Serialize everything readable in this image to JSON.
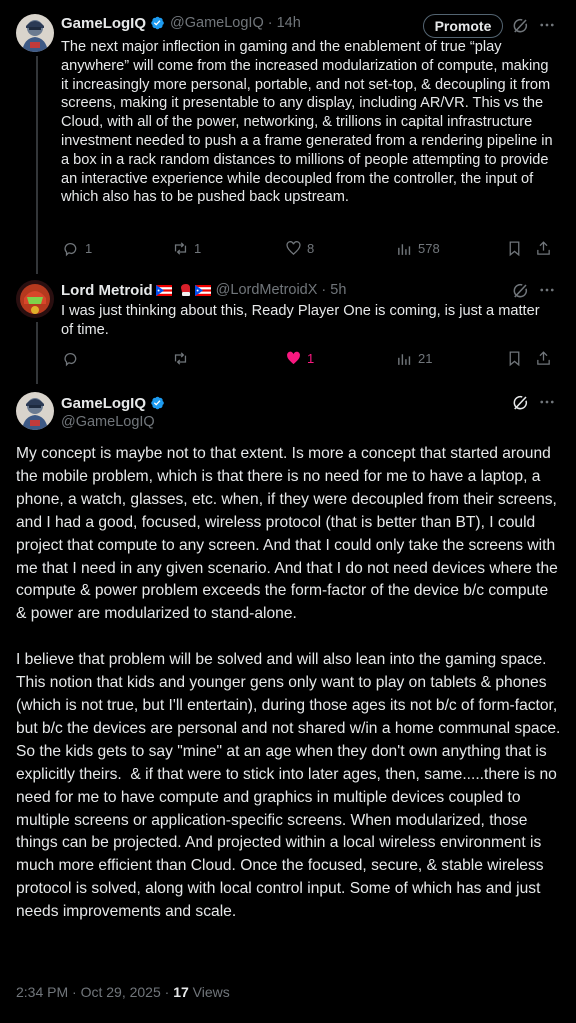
{
  "tweet1": {
    "name": "GameLogIQ",
    "handle": "@GameLogIQ",
    "time": "14h",
    "promote_label": "Promote",
    "text": "The next major inflection in gaming and the enablement of true “play anywhere” will come from the increased modularization of compute, making it increasingly more personal, portable, and not set-top, & decoupling it from screens, making it presentable to any display, including AR/VR. This vs the Cloud, with all of the power, networking, & trillions in capital infrastructure investment needed to push a a frame generated from a rendering pipeline in a box in a rack random distances to millions of people attempting to provide an interactive experience while decoupled from the controller, the input of which also has to be pushed back upstream.",
    "replies": "1",
    "reposts": "1",
    "likes": "8",
    "views": "578"
  },
  "tweet2": {
    "name": "Lord Metroid",
    "handle": "@LordMetroidX",
    "time": "5h",
    "text": "I was just thinking about this, Ready Player One is coming, is just a matter of time.",
    "likes": "1",
    "views": "21"
  },
  "tweet3": {
    "name": "GameLogIQ",
    "handle": "@GameLogIQ",
    "text": "My concept is maybe not to that extent. Is more a concept that started around the mobile problem, which is that there is no need for me to have a laptop, a phone, a watch, glasses, etc. when, if they were decoupled from their screens, and I had a good, focused, wireless protocol (that is better than BT), I could project that compute to any screen. And that I could only take the screens with me that I need in any given scenario. And that I do not need devices where the compute & power problem exceeds the form-factor of the device b/c compute & power are modularized to stand-alone.\n\nI believe that problem will be solved and will also lean into the gaming space. This notion that kids and younger gens only want to play on tablets & phones (which is not true, but I'll entertain), during those ages its not b/c of form-factor, but b/c the devices are personal and not shared w/in a home communal space. So the kids gets to say \"mine\" at an age when they don't own anything that is explicitly theirs.  & if that were to stick into later ages, then, same.....there is no need for me to have compute and graphics in multiple devices coupled to multiple screens or application-specific screens. When modularized, those things can be projected. And projected within a local wireless environment is much more efficient than Cloud. Once the focused, secure, & stable wireless protocol is solved, along with local control input. Some of which has and just needs improvements and scale.",
    "timestamp": "2:34 PM · Oct 29, 2025 ·",
    "view_count": "17",
    "views_label": "Views"
  },
  "colors": {
    "background": "#000000",
    "text": "#e7e9ea",
    "muted": "#71767b",
    "verified": "#1d9bf0",
    "like": "#f91880",
    "divider": "#2f3336"
  },
  "icons": [
    "verified-badge-icon",
    "grok-icon",
    "more-icon",
    "reply-icon",
    "repost-icon",
    "like-icon",
    "views-icon",
    "bookmark-icon",
    "share-icon",
    "flag-icon",
    "boxing-glove-icon"
  ]
}
